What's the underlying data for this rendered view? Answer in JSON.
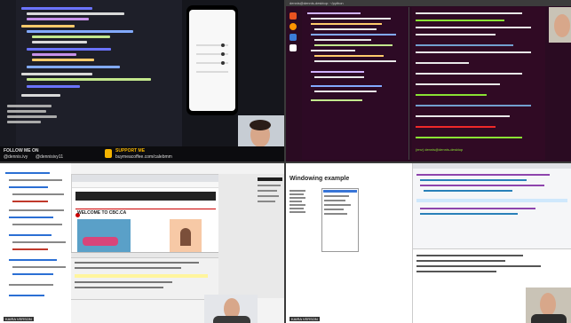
{
  "top_left": {
    "follow_label": "FOLLOW ME ON",
    "social_handle_1": "@dennis.ivy",
    "social_handle_2": "@dennisivy11",
    "support_title": "SUPPORT ME",
    "support_url": "buymeacoffee.com/calebmm"
  },
  "top_right": {
    "window_title": "dennis@dennis-desktop: ~/python",
    "prompt_label": "(env) dennis@dennis-desktop"
  },
  "bottom_left": {
    "page_heading": "WELCOME TO CBC.CA",
    "footer_label": "KAIRA VERSON"
  },
  "bottom_right": {
    "window_title": "Windowing example",
    "footer_label": "KAIRA VERSON"
  },
  "colors": {
    "editor_bg": "#1e1f29",
    "terminal_bg": "#2a0b22",
    "accent": "#f5b400"
  }
}
